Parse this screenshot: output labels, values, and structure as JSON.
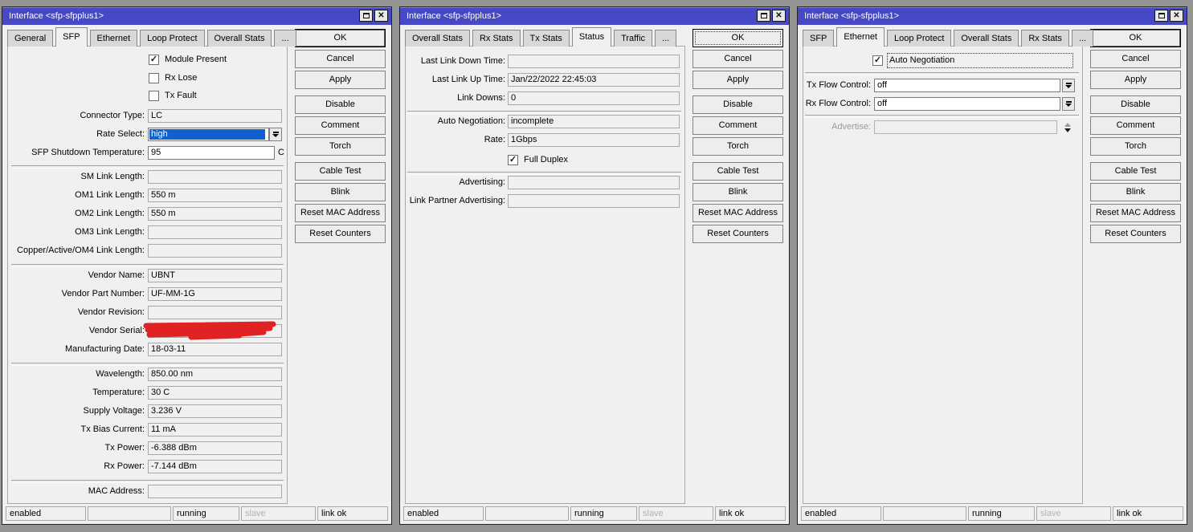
{
  "icons": {
    "check": "✓",
    "close": "✕",
    "maximize": "maximize-box",
    "dropdown": "down-arrow-with-bar",
    "spinner": "up-down-arrows"
  },
  "colors": {
    "titlebar": "#4648c6",
    "selection_blue": "#1060d0",
    "desktop": "#949494",
    "window_bg": "#f0f0f0",
    "scribble_red": "#e02222"
  },
  "w1": {
    "title": "Interface <sfp-sfpplus1>",
    "tabs": [
      "General",
      "SFP",
      "Ethernet",
      "Loop Protect",
      "Overall Stats",
      "..."
    ],
    "selected_tab": "SFP",
    "checks": {
      "module_present": {
        "label": "Module Present",
        "checked": true
      },
      "rx_lose": {
        "label": "Rx Lose",
        "checked": false
      },
      "tx_fault": {
        "label": "Tx Fault",
        "checked": false
      }
    },
    "fields": {
      "connector_type": {
        "label": "Connector Type:",
        "value": "LC"
      },
      "rate_select": {
        "label": "Rate Select:",
        "value": "high",
        "selected": true
      },
      "sfp_shutdown_temperature": {
        "label": "SFP Shutdown Temperature:",
        "value": "95",
        "suffix": "C"
      },
      "sm_link_length": {
        "label": "SM Link Length:",
        "value": ""
      },
      "om1_link_length": {
        "label": "OM1 Link Length:",
        "value": "550 m"
      },
      "om2_link_length": {
        "label": "OM2 Link Length:",
        "value": "550 m"
      },
      "om3_link_length": {
        "label": "OM3 Link Length:",
        "value": ""
      },
      "copper_active_om4_link_length": {
        "label": "Copper/Active/OM4 Link Length:",
        "value": ""
      },
      "vendor_name": {
        "label": "Vendor Name:",
        "value": "UBNT"
      },
      "vendor_part_number": {
        "label": "Vendor Part Number:",
        "value": "UF-MM-1G"
      },
      "vendor_revision": {
        "label": "Vendor Revision:",
        "value": ""
      },
      "vendor_serial": {
        "label": "Vendor Serial:",
        "value": "",
        "masked": "red-scribble-redaction"
      },
      "manufacturing_date": {
        "label": "Manufacturing Date:",
        "value": "18-03-11"
      },
      "wavelength": {
        "label": "Wavelength:",
        "value": "850.00 nm"
      },
      "temperature": {
        "label": "Temperature:",
        "value": "30 C"
      },
      "supply_voltage": {
        "label": "Supply Voltage:",
        "value": "3.236 V"
      },
      "tx_bias_current": {
        "label": "Tx Bias Current:",
        "value": "11 mA"
      },
      "tx_power": {
        "label": "Tx Power:",
        "value": "-6.388 dBm"
      },
      "rx_power": {
        "label": "Rx Power:",
        "value": "-7.144 dBm"
      },
      "mac_address": {
        "label": "MAC Address:",
        "value": ""
      }
    },
    "buttons": [
      "OK",
      "Cancel",
      "Apply",
      "Disable",
      "Comment",
      "Torch",
      "Cable Test",
      "Blink",
      "Reset MAC Address",
      "Reset Counters"
    ],
    "status": [
      "enabled",
      "",
      "running",
      "slave",
      "link ok"
    ]
  },
  "w2": {
    "title": "Interface <sfp-sfpplus1>",
    "tabs": [
      "Overall Stats",
      "Rx Stats",
      "Tx Stats",
      "Status",
      "Traffic",
      "..."
    ],
    "selected_tab": "Status",
    "fields": {
      "last_link_down_time": {
        "label": "Last Link Down Time:",
        "value": ""
      },
      "last_link_up_time": {
        "label": "Last Link Up Time:",
        "value": "Jan/22/2022 22:45:03"
      },
      "link_downs": {
        "label": "Link Downs:",
        "value": "0"
      },
      "auto_negotiation": {
        "label": "Auto Negotiation:",
        "value": "incomplete"
      },
      "rate": {
        "label": "Rate:",
        "value": "1Gbps"
      },
      "advertising": {
        "label": "Advertising:",
        "value": ""
      },
      "link_partner_advertising": {
        "label": "Link Partner Advertising:",
        "value": ""
      }
    },
    "checks": {
      "full_duplex": {
        "label": "Full Duplex",
        "checked": true
      }
    },
    "buttons": [
      "OK",
      "Cancel",
      "Apply",
      "Disable",
      "Comment",
      "Torch",
      "Cable Test",
      "Blink",
      "Reset MAC Address",
      "Reset Counters"
    ],
    "status": [
      "enabled",
      "",
      "running",
      "slave",
      "link ok"
    ]
  },
  "w3": {
    "title": "Interface <sfp-sfpplus1>",
    "tabs": [
      "SFP",
      "Ethernet",
      "Loop Protect",
      "Overall Stats",
      "Rx Stats",
      "..."
    ],
    "selected_tab": "Ethernet",
    "checks": {
      "auto_negotiation": {
        "label": "Auto Negotiation",
        "checked": true,
        "focused": true
      }
    },
    "fields": {
      "tx_flow_control": {
        "label": "Tx Flow Control:",
        "value": "off"
      },
      "rx_flow_control": {
        "label": "Rx Flow Control:",
        "value": "off"
      },
      "advertise": {
        "label": "Advertise:",
        "value": "",
        "disabled": true
      }
    },
    "buttons": [
      "OK",
      "Cancel",
      "Apply",
      "Disable",
      "Comment",
      "Torch",
      "Cable Test",
      "Blink",
      "Reset MAC Address",
      "Reset Counters"
    ],
    "status": [
      "enabled",
      "",
      "running",
      "slave",
      "link ok"
    ]
  }
}
